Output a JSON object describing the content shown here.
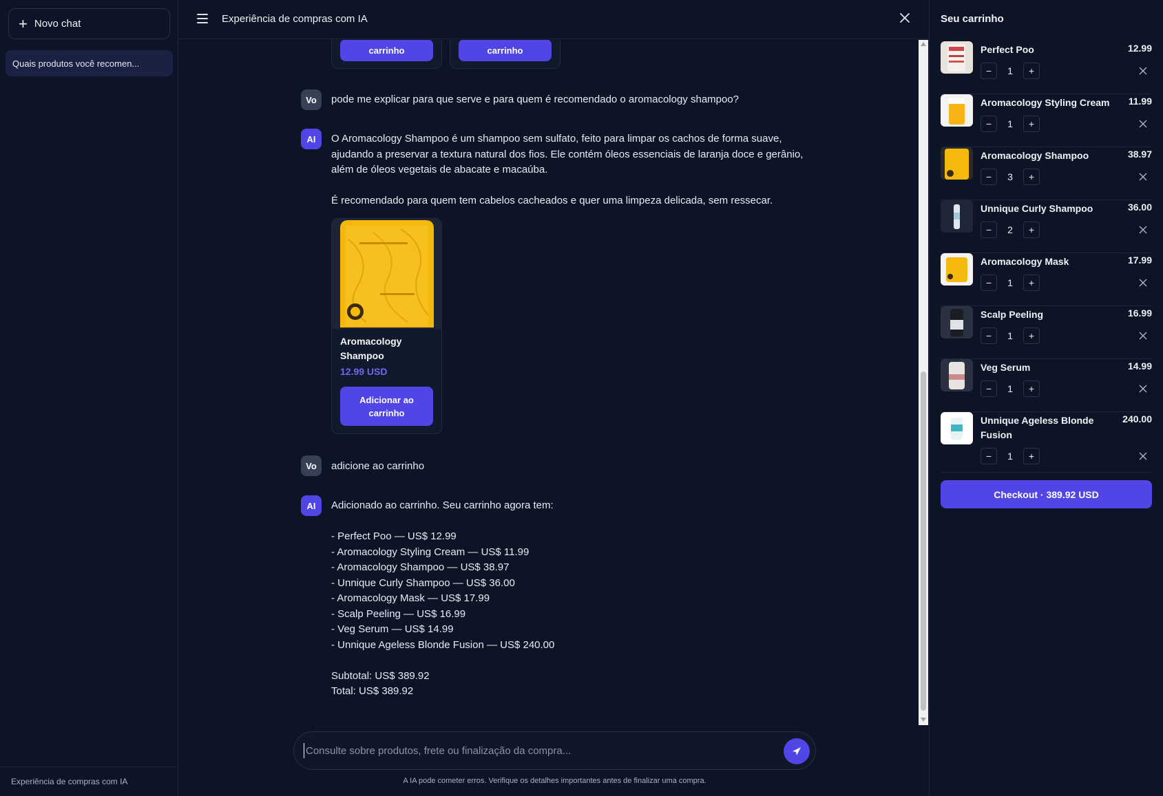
{
  "sidebar": {
    "new_chat_label": "Novo chat",
    "history": [
      {
        "label": "Quais produtos você recomen..."
      }
    ],
    "footer": "Experiência de compras com IA"
  },
  "header": {
    "title": "Experiência de compras com IA"
  },
  "chat": {
    "top_cards": [
      {
        "button_label": "carrinho"
      },
      {
        "button_label": "carrinho"
      }
    ],
    "messages": [
      {
        "role": "user",
        "avatar": "Vo",
        "text": "pode me explicar para que serve e para quem é recomendado o aromacology shampoo?"
      },
      {
        "role": "ai",
        "avatar": "AI",
        "lines": [
          "O Aromacology Shampoo é um shampoo sem sulfato, feito para limpar os cachos de forma suave,",
          "ajudando a preservar a textura natural dos fios. Ele contém óleos essenciais de laranja doce e gerânio,",
          "além de óleos vegetais de abacate e macaúba.",
          "É recomendado para quem tem cabelos cacheados e quer uma limpeza delicada, sem ressecar."
        ],
        "product": {
          "name": "Aromacology Shampoo",
          "price": "12.99 USD",
          "button_label": "Adicionar ao carrinho"
        }
      },
      {
        "role": "user",
        "avatar": "Vo",
        "text": "adicione ao carrinho"
      },
      {
        "role": "ai",
        "avatar": "AI",
        "intro": "Adicionado ao carrinho. Seu carrinho agora tem:",
        "list": [
          "- Perfect Poo — US$ 12.99",
          "- Aromacology Styling Cream — US$ 11.99",
          "- Aromacology Shampoo — US$ 38.97",
          "- Unnique Curly Shampoo — US$ 36.00",
          "- Aromacology Mask — US$ 17.99",
          "- Scalp Peeling — US$ 16.99",
          "- Veg Serum — US$ 14.99",
          "- Unnique Ageless Blonde Fusion — US$ 240.00"
        ],
        "subtotal": "Subtotal: US$ 389.92",
        "total": "Total: US$ 389.92"
      }
    ]
  },
  "input": {
    "placeholder": "Consulte sobre produtos, frete ou finalização da compra...",
    "value": "",
    "disclaimer": "A IA pode cometer erros. Verifique os detalhes importantes antes de finalizar uma compra."
  },
  "cart": {
    "title": "Seu carrinho",
    "items": [
      {
        "name": "Perfect Poo",
        "price": "12.99",
        "qty": "1"
      },
      {
        "name": "Aromacology Styling Cream",
        "price": "11.99",
        "qty": "1"
      },
      {
        "name": "Aromacology Shampoo",
        "price": "38.97",
        "qty": "3"
      },
      {
        "name": "Unnique Curly Shampoo",
        "price": "36.00",
        "qty": "2"
      },
      {
        "name": "Aromacology Mask",
        "price": "17.99",
        "qty": "1"
      },
      {
        "name": "Scalp Peeling",
        "price": "16.99",
        "qty": "1"
      },
      {
        "name": "Veg Serum",
        "price": "14.99",
        "qty": "1"
      },
      {
        "name": "Unnique Ageless Blonde Fusion",
        "price": "240.00",
        "qty": "1"
      }
    ],
    "decrement_symbol": "−",
    "increment_symbol": "+",
    "checkout_label": "Checkout · 389.92 USD"
  },
  "colors": {
    "accent": "#4f46e5",
    "background": "#0d1425",
    "price_accent": "#6d68f0"
  }
}
